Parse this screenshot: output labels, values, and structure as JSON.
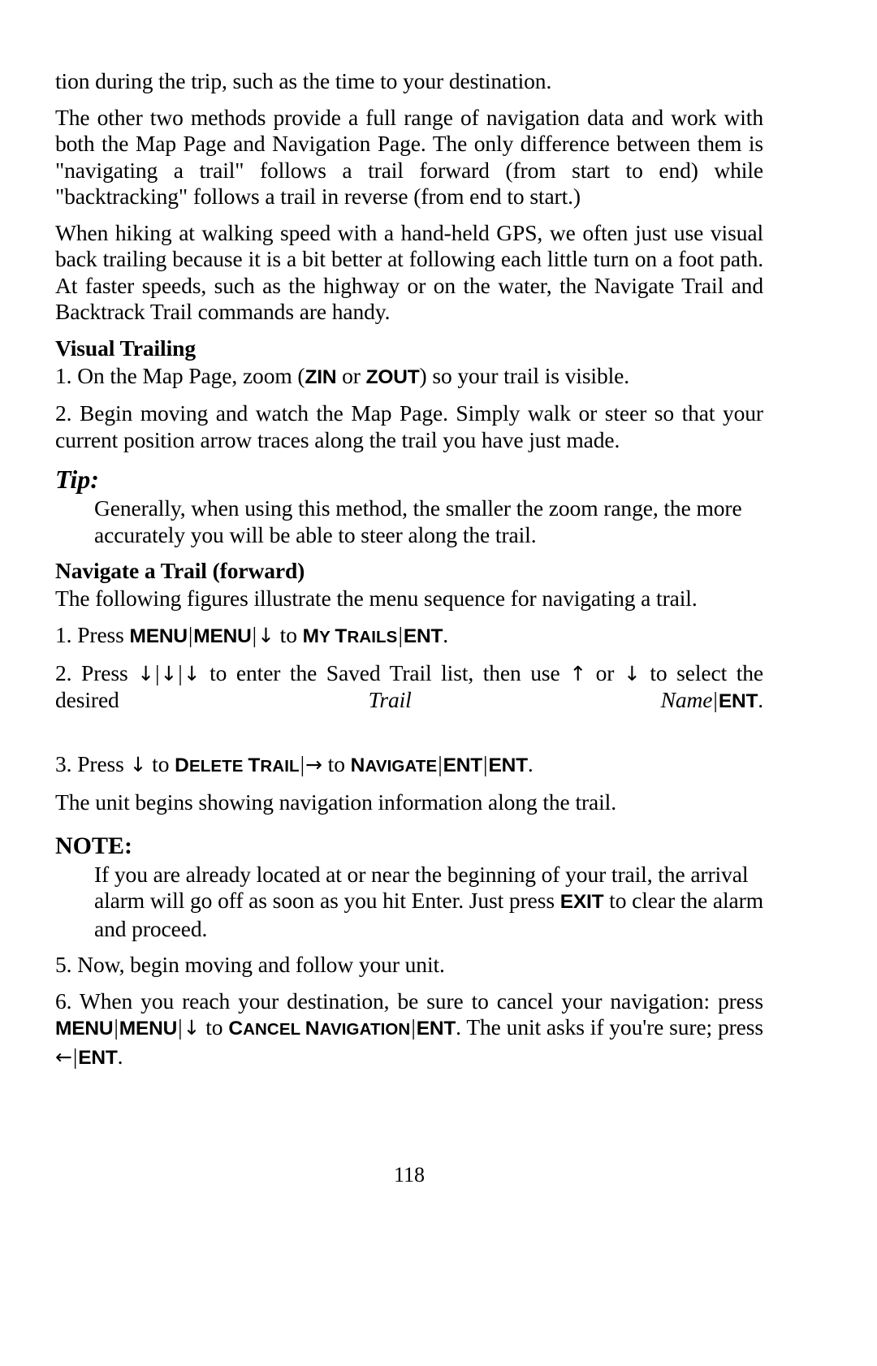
{
  "document": {
    "page_number": "118"
  },
  "content": {
    "para_continued": "tion during the trip, such as the time to your destination.",
    "para_methods": "The other two methods provide a full range of navigation data and work with both the Map Page and Navigation Page. The only difference between them is \"navigating a trail\" follows a trail forward (from start to end) while \"backtracking\" follows a trail in reverse (from end to start.)",
    "para_hiking": "When hiking at walking speed with a hand-held GPS, we often just use visual back trailing because it is a bit better at following each little turn on a foot path. At faster speeds, such as the highway or on the water, the Navigate Trail and Backtrack Trail commands are handy.",
    "heading_visual_trailing": "Visual Trailing",
    "step_v1_pre": "1. On the Map Page, zoom (",
    "step_v1_key_zin": "ZIN",
    "step_v1_mid": " or ",
    "step_v1_key_zout": "ZOUT",
    "step_v1_post": ") so your trail is visible.",
    "step_v2": "2. Begin moving and watch the Map Page. Simply walk or steer so that your current position arrow traces along the trail you have just made.",
    "heading_tip": "Tip:",
    "tip_body": "Generally, when using this method, the smaller the zoom range, the more accurately you will be able to steer along the trail.",
    "heading_navigate_trail": "Navigate a Trail (forward)",
    "para_following_figures": "The following figures illustrate the menu sequence for navigating a trail.",
    "step_1_pre": "1. Press ",
    "step_1_key_menu_a": "MENU",
    "step_1_key_menu_b": "MENU",
    "step_1_arrow_down": "↓",
    "step_1_mid": " to ",
    "step_1_menu_my_trails": "My Trails",
    "step_1_key_ent": "ENT",
    "step_1_post": ".",
    "step_2_pre": "2. Press ",
    "step_2_arrow_1": "↓",
    "step_2_arrow_2": "↓",
    "step_2_arrow_3": "↓",
    "step_2_mid": " to enter the Saved Trail list, then use ",
    "step_2_arrow_up": "↑",
    "step_2_mid2": " or ",
    "step_2_arrow_down": "↓",
    "step_2_mid3": " to select the desired ",
    "step_2_italic_trail_name": "Trail Name",
    "step_2_key_ent": "ENT",
    "step_2_post": ".",
    "step_3_pre": "3. Press ",
    "step_3_arrow_down": "↓",
    "step_3_mid": " to ",
    "step_3_menu_delete_trail": "Delete Trail",
    "step_3_arrow_right": "→",
    "step_3_mid2": " to ",
    "step_3_menu_navigate": "Navigate",
    "step_3_key_ent_a": "ENT",
    "step_3_key_ent_b": "ENT",
    "step_3_post": ".",
    "para_unit_begins": "The unit begins showing navigation information along the trail.",
    "heading_note": "NOTE:",
    "note_pre": "If you are already located at or near the beginning of your trail, the arrival alarm will go off as soon as you hit Enter. Just press ",
    "note_key_exit": "EXIT",
    "note_post": " to clear the alarm and proceed.",
    "step_5": "5. Now, begin moving and follow your unit.",
    "step_6_pre": "6. When you reach your destination, be sure to cancel your navigation: press ",
    "step_6_key_menu_a": "MENU",
    "step_6_key_menu_b": "MENU",
    "step_6_arrow_down": "↓",
    "step_6_mid": " to ",
    "step_6_menu_cancel_navigation": "Cancel Navigation",
    "step_6_key_ent": "ENT",
    "step_6_mid2": ". The unit asks if you're sure; press ",
    "step_6_arrow_left": "←",
    "step_6_key_ent_b": "ENT",
    "step_6_post": "."
  }
}
